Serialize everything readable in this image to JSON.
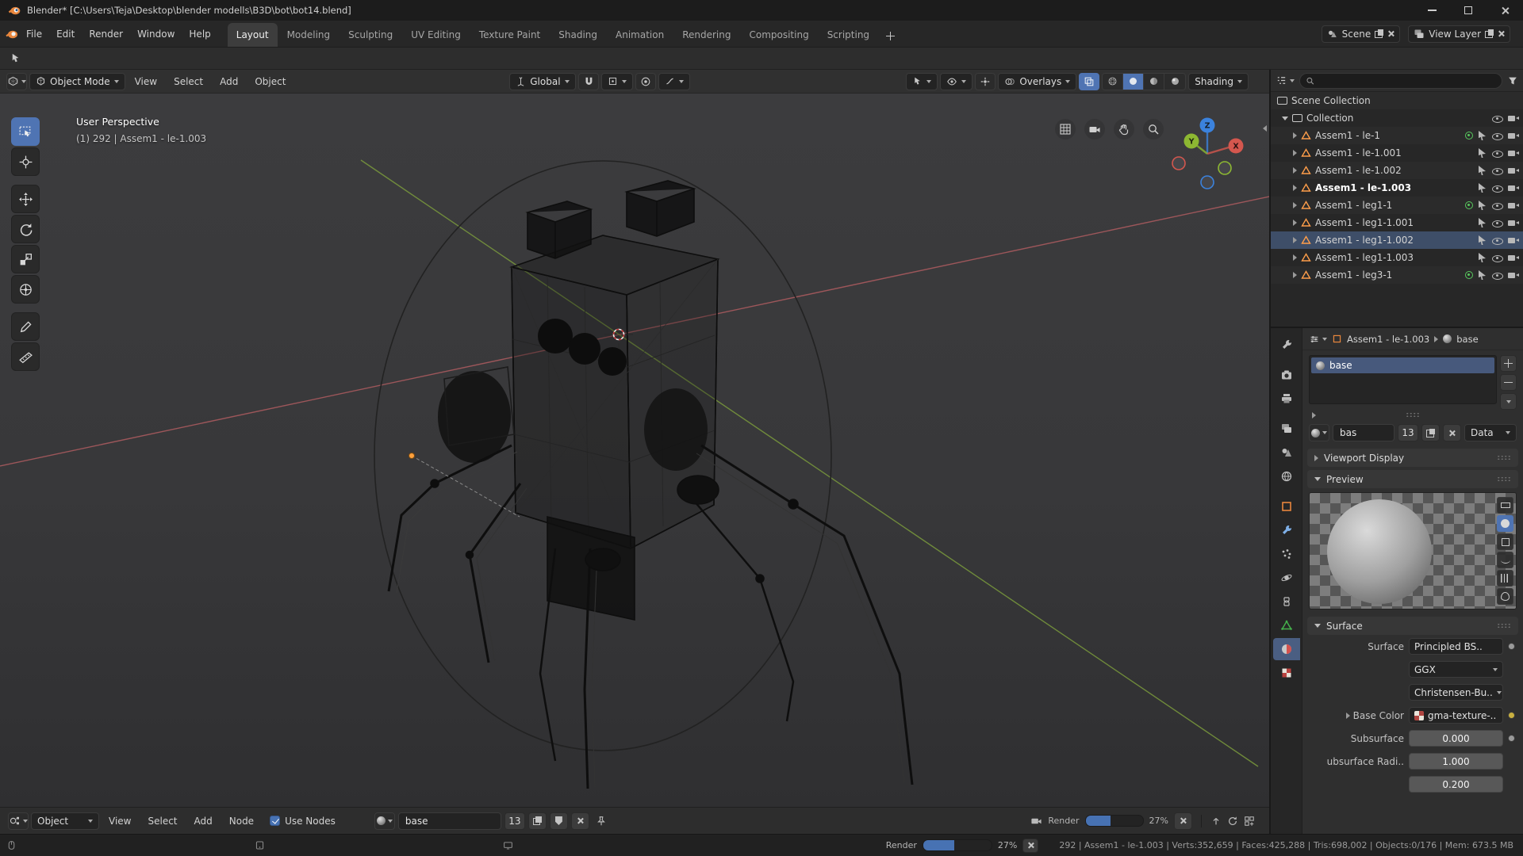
{
  "colors": {
    "accent": "#4772b3",
    "blender_orange": "#e8863d",
    "axis_x": "#b5545a",
    "axis_y": "#7a9a3c",
    "axis_z": "#3b82dd"
  },
  "titlebar": {
    "title": "Blender* [C:\\Users\\Teja\\Desktop\\blender modells\\B3D\\bot\\bot14.blend]"
  },
  "topbar": {
    "menus": [
      "File",
      "Edit",
      "Render",
      "Window",
      "Help"
    ],
    "workspaces": [
      "Layout",
      "Modeling",
      "Sculpting",
      "UV Editing",
      "Texture Paint",
      "Shading",
      "Animation",
      "Rendering",
      "Compositing",
      "Scripting"
    ],
    "active_workspace": "Layout",
    "scene_label": "Scene",
    "view_layer_label": "View Layer"
  },
  "viewport": {
    "header": {
      "mode": "Object Mode",
      "menus": [
        "View",
        "Select",
        "Add",
        "Object"
      ],
      "orientation": "Global",
      "overlays_label": "Overlays",
      "shading_label": "Shading"
    },
    "overlay": {
      "view_label": "User Perspective",
      "info_label": "(1) 292 | Assem1 - le-1.003"
    },
    "gizmo": {
      "x": "X",
      "y": "Y",
      "z": "Z"
    }
  },
  "outliner": {
    "scene_collection": "Scene Collection",
    "collection": "Collection",
    "objects": [
      {
        "name": "Assem1 - le-1"
      },
      {
        "name": "Assem1 - le-1.001"
      },
      {
        "name": "Assem1 - le-1.002"
      },
      {
        "name": "Assem1 - le-1.003"
      },
      {
        "name": "Assem1 - leg1-1"
      },
      {
        "name": "Assem1 - leg1-1.001"
      },
      {
        "name": "Assem1 - leg1-1.002"
      },
      {
        "name": "Assem1 - leg1-1.003"
      },
      {
        "name": "Assem1 - leg3-1"
      }
    ]
  },
  "properties": {
    "breadcrumb_object": "Assem1 - le-1.003",
    "breadcrumb_material": "base",
    "slot_name": "base",
    "datablock_name": "bas",
    "datablock_users": "13",
    "datablock_link": "Data",
    "panel_viewport_display": "Viewport Display",
    "panel_preview": "Preview",
    "panel_surface": "Surface",
    "surface_label": "Surface",
    "surface_value": "Principled BS..",
    "distribution_value": "GGX",
    "subsurface_method_value": "Christensen-Bu..",
    "base_color_label": "Base Color",
    "base_color_value": "gma-texture-..",
    "subsurface_label": "Subsurface",
    "subsurface_value": "0.000",
    "radius_label": "ubsurface Radi..",
    "radius_value": "1.000",
    "radius_value_2": "0.200"
  },
  "shader_editor": {
    "mode": "Object",
    "menus": [
      "View",
      "Select",
      "Add",
      "Node"
    ],
    "use_nodes_label": "Use Nodes",
    "material_name": "base",
    "material_users": "13"
  },
  "render_progress": {
    "label": "Render",
    "percent": "27%"
  },
  "statusbar": {
    "render_label": "Render",
    "percent": "27%",
    "stats": "292 | Assem1 - le-1.003 | Verts:352,659 | Faces:425,288 | Tris:698,002 | Objects:0/176 | Mem: 673.5 MB"
  }
}
